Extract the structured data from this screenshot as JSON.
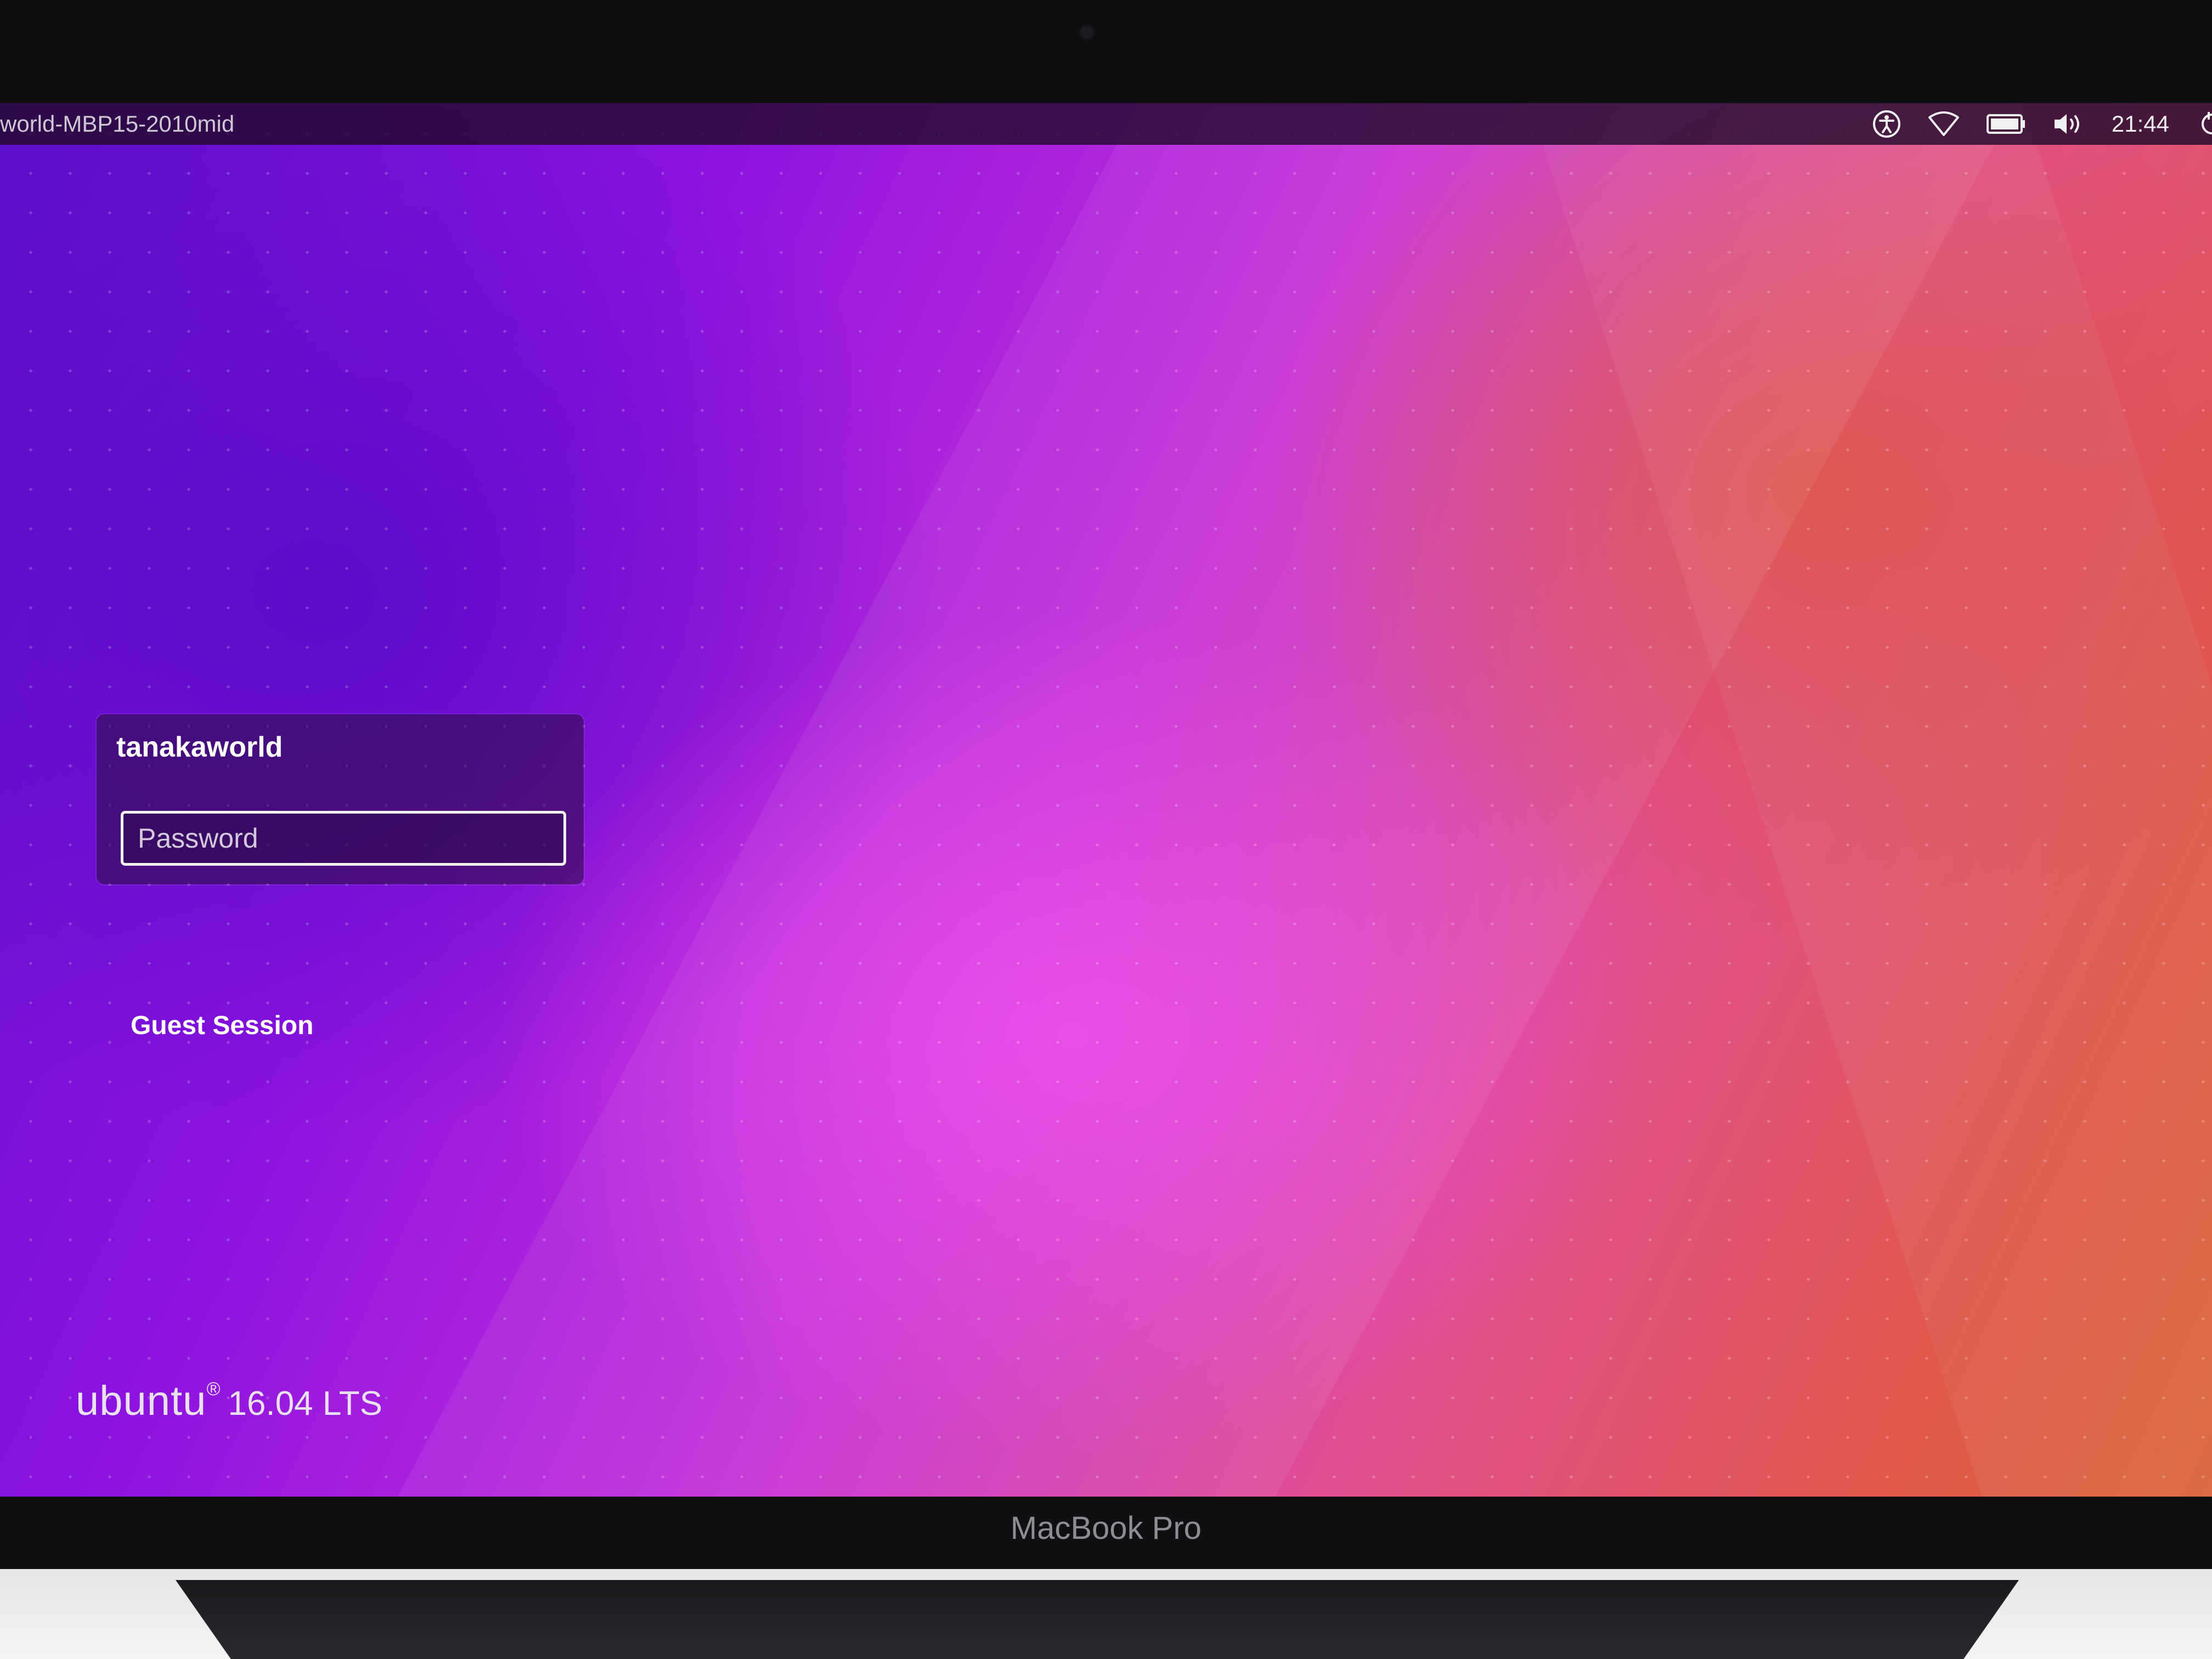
{
  "top_panel": {
    "hostname": "world-MBP15-2010mid",
    "clock": "21:44",
    "indicators": [
      "accessibility-icon",
      "wifi-icon",
      "battery-icon",
      "volume-icon",
      "power-icon"
    ]
  },
  "login": {
    "username": "tanakaworld",
    "password_placeholder": "Password",
    "password_value": "",
    "guest_label": "Guest Session"
  },
  "branding": {
    "logo": "ubuntu",
    "registered": "®",
    "version": "16.04 LTS"
  },
  "device": {
    "label": "MacBook Pro"
  },
  "colors": {
    "wallpaper_left": "#5b0fc9",
    "wallpaper_center": "#c42fd8",
    "wallpaper_right": "#e0584a",
    "panel": "#230a2d"
  }
}
